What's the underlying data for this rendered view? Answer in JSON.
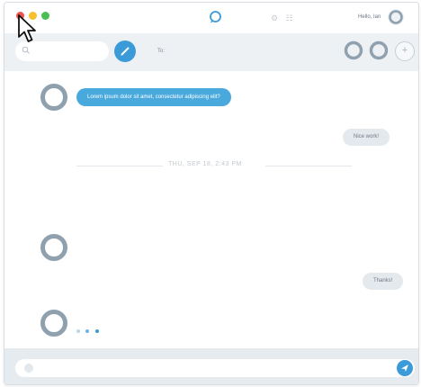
{
  "window": {
    "greeting": "Hello, Ian",
    "title_icons": "⚙ ☷"
  },
  "toolbar": {
    "search_placeholder": "",
    "to_label": "To:",
    "add_label": "+"
  },
  "messages": {
    "incoming_1": "Lorem ipsum dolor sit amet, consectetur adipiscing elit?",
    "outgoing_1": "Nice work!",
    "timestamp": "THU, SEP 18, 2:43 PM",
    "outgoing_2": "Thanks!"
  },
  "composer": {
    "placeholder": ""
  },
  "colors": {
    "accent": "#3b9bd8",
    "incoming_bubble": "#4aa9dc",
    "outgoing_bubble": "#e4e9ed",
    "close": "#ef5350",
    "minimize": "#f5c12e",
    "zoom": "#4cbe55",
    "typing_dots": [
      "#b8d8ee",
      "#6cb4e4",
      "#3b9bd8"
    ]
  },
  "icons": {
    "app_logo": "chat-bubble-icon",
    "compose": "pencil-icon",
    "send": "paper-plane-icon",
    "search": "magnifier-icon",
    "cursor": "mouse-pointer-icon"
  }
}
